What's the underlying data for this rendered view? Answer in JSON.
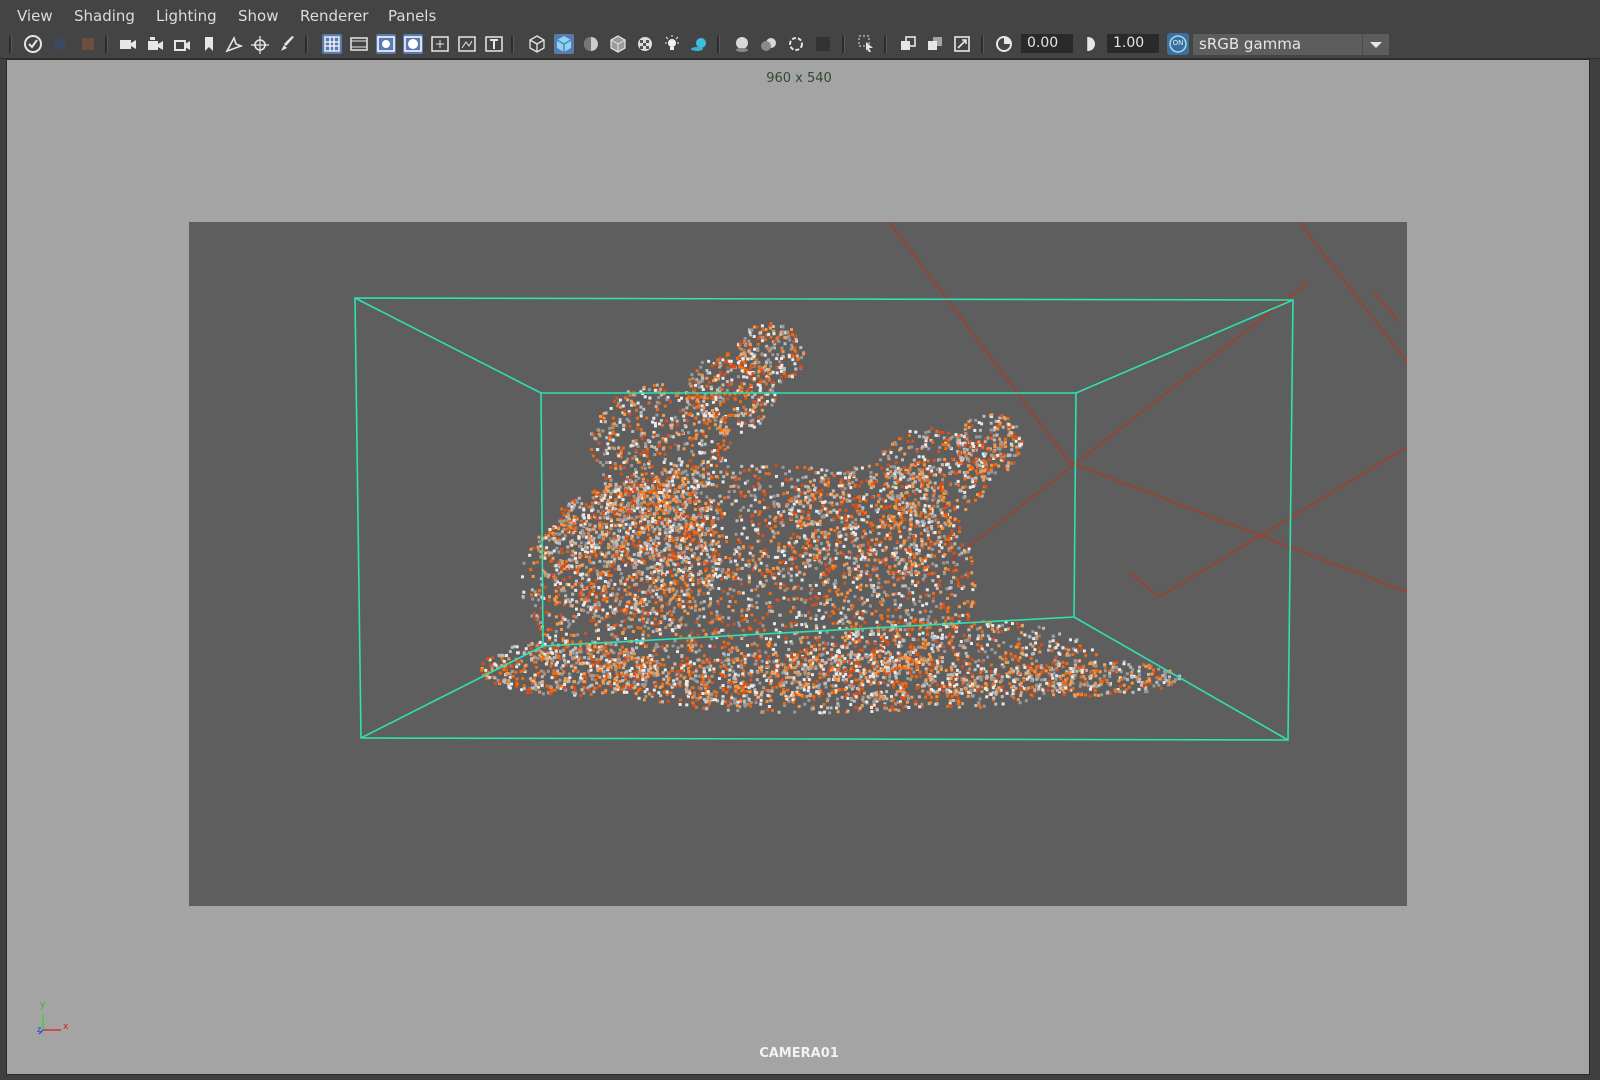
{
  "menubar": {
    "items": [
      "View",
      "Shading",
      "Lighting",
      "Show",
      "Renderer",
      "Panels"
    ]
  },
  "toolbar": {
    "exposure_value": "0.00",
    "gamma_value": "1.00",
    "color_management_badge": "ON",
    "view_transform": "sRGB gamma"
  },
  "viewport": {
    "resolution_label": "960 x 540",
    "camera_name": "CAMERA01",
    "axis_labels": {
      "x": "x",
      "y": "y",
      "z": "z"
    }
  },
  "colors": {
    "bounding_box": "#2fe0b2",
    "light_lines": "#b0381c",
    "particle_orange": "#f26a12",
    "particle_white": "#e9e9e9"
  }
}
